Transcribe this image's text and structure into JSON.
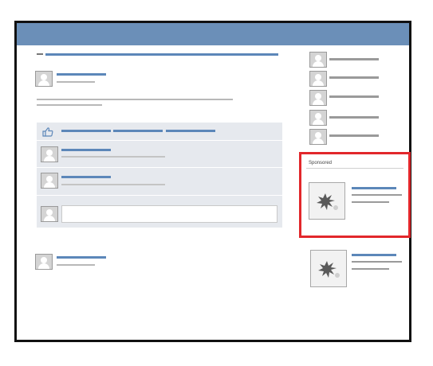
{
  "sponsored": {
    "label": "Sponsored"
  },
  "colors": {
    "topbar": "#6b8fb8",
    "link_line": "#5c87b9",
    "text_line": "#b8b8b8",
    "sponsored_highlight": "#e2272b",
    "comment_background": "#e6e9ee"
  },
  "icons": {
    "like": "thumbs-up-icon",
    "avatar": "avatar-icon",
    "ad_image": "starburst-image-icon"
  }
}
